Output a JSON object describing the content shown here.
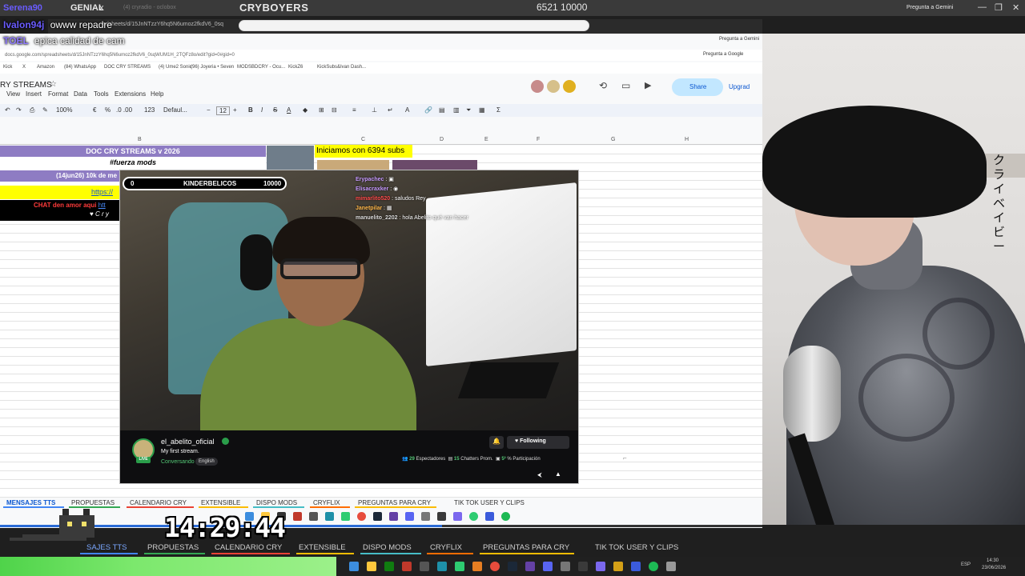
{
  "browser": {
    "tab_prefix": "x",
    "tab_genial": "GENIAL",
    "tab_second": "(4) cryradio - oclobox",
    "title": "CRYBOYERS",
    "counter": "6521  10000",
    "gemini_label": "Pregunta a Gemini",
    "win_controls": [
      "—",
      "❐",
      "✕"
    ]
  },
  "overlay_chat": [
    {
      "name": "Serena90",
      "color": "#6a5cff"
    },
    {
      "name": "Ivalon94j",
      "text": "owww repadre",
      "color": "#6a5cff"
    },
    {
      "name": "TOEL",
      "text": "epica calidad de cam",
      "color": "#8f7bff"
    }
  ],
  "url": {
    "full": "docs.google.com/spreadsheets/d/15JnNTzzY6hq5N6umoz2fkdV6_0sqWUM1H_2TQFz8o/edit?gid=0#gid=0",
    "short": "adsheets/d/15JnNTzzY6hq5N6umoz2fkdV6_0sq"
  },
  "bookmarks": [
    "Kick",
    "X",
    "Amazon",
    "(84) WhatsApp",
    "DOC CRY STREAMS",
    "(4) Ume2 Sonic",
    "(96) Joyeria • Seven",
    "MODSBDCRY - Ocu...",
    "KickZ6",
    "KickSubs&Ivan Dash..."
  ],
  "sheets": {
    "doc_title": "RY STREAMS",
    "menu": [
      "View",
      "Insert",
      "Format",
      "Data",
      "Tools",
      "Extensions",
      "Help"
    ],
    "toolbar": {
      "zoom": "100%",
      "currency": "€",
      "percent": "%",
      "decimals": ".0  .00",
      "num_format": "123",
      "font": "Defaul...",
      "font_size": "12"
    },
    "share_label": "Share",
    "upgrade_label": "Upgrad",
    "gemini_label": "Pregunta a Google",
    "columns": [
      "B",
      "C",
      "D",
      "E",
      "F",
      "G",
      "H"
    ],
    "cells": {
      "doc_header": "DOC CRY STREAMS v 2026",
      "fuerza": "#fuerza mods",
      "date_row": "(14jun26) 10k de me",
      "link": "https://",
      "chat_prefix": "CHAT den amor aqui",
      "chat_link": "htt",
      "cry_tag": "♥ C r y",
      "iniciamos": "Iniciamos con 6394 subs"
    },
    "tabs": [
      {
        "label": "MENSAJES TTS",
        "color": "#4285f4",
        "active": true
      },
      {
        "label": "PROPUESTAS",
        "color": "#34a853"
      },
      {
        "label": "CALENDARIO CRY",
        "color": "#ea4335"
      },
      {
        "label": "EXTENSIBLE",
        "color": "#fbbc04"
      },
      {
        "label": "DISPO MODS",
        "color": "#46bdc6"
      },
      {
        "label": "CRYFLIX",
        "color": "#ff6d01"
      },
      {
        "label": "PREGUNTAS PARA CRY",
        "color": "#fbbc04"
      },
      {
        "label": "TIK TOK USER Y CLIPS",
        "color": "#9334e6"
      }
    ]
  },
  "stream": {
    "goal": {
      "current": "0",
      "name": "KINDERBELICOS",
      "target": "10000"
    },
    "chat": [
      {
        "user": "Erypachec",
        "text": "",
        "color": "#c79bff"
      },
      {
        "user": "Elisacraxker",
        "text": "",
        "color": "#c79bff"
      },
      {
        "user": "mimarlito520",
        "text": "saludos Rey",
        "color": "#ff4b4b"
      },
      {
        "user": "Janetpilar",
        "text": "",
        "color": "#ffb84b"
      },
      {
        "user": "manuelito_2202",
        "text": "hola Abelito qué van hacer",
        "color": "#dddddd"
      }
    ],
    "channel": "el_abelito_oficial",
    "title": "My first stream.",
    "category": "Conversando",
    "language": "English",
    "live_badge": "LIVE",
    "follow_label": "Following",
    "stats": {
      "viewers": "29",
      "viewers_label": "Espectadores",
      "chatters": "15",
      "chatters_label": "Chatters Prom.",
      "participation": "5²",
      "participation_label": "% Participación"
    }
  },
  "webcam": {
    "jp_text": "クライベイビー"
  },
  "bottom": {
    "clock": "14:29:44",
    "tabs": [
      {
        "label": "SAJES TTS",
        "color": "#4285f4"
      },
      {
        "label": "PROPUESTAS",
        "color": "#34a853"
      },
      {
        "label": "CALENDARIO CRY",
        "color": "#ea4335"
      },
      {
        "label": "EXTENSIBLE",
        "color": "#fbbc04"
      },
      {
        "label": "DISPO MODS",
        "color": "#46bdc6"
      },
      {
        "label": "CRYFLIX",
        "color": "#ff6d01"
      },
      {
        "label": "PREGUNTAS PARA CRY",
        "color": "#fbbc04"
      },
      {
        "label": "TIK TOK USER Y CLIPS",
        "color": "#9334e6"
      }
    ],
    "tray": {
      "lang": "ESP",
      "time": "14:30",
      "date": "23/06/2026"
    }
  },
  "colors": {
    "accent": "#0b57d0",
    "twitch_green": "#53c775",
    "sheet_purple": "#8e7cc3"
  }
}
